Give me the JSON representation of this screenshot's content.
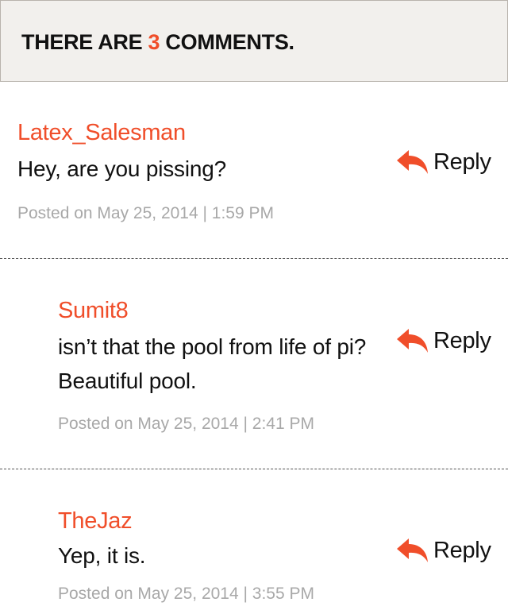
{
  "header": {
    "prefix": "There are ",
    "count": "3",
    "suffix": " comments."
  },
  "comments": [
    {
      "author": "Latex_Salesman",
      "text": "Hey, are you pissing?",
      "meta": "Posted on May 25, 2014 | 1:59 PM",
      "reply_label": "Reply"
    },
    {
      "author": "Sumit8",
      "text": "isn’t that the pool from life of pi? Beautiful pool.",
      "meta": "Posted on May 25, 2014 | 2:41 PM",
      "reply_label": "Reply"
    },
    {
      "author": "TheJaz",
      "text": "Yep, it is.",
      "meta": "Posted on May 25, 2014 | 3:55 PM",
      "reply_label": "Reply"
    }
  ],
  "colors": {
    "accent": "#f04e2a",
    "header_bg": "#f2f0ed",
    "meta_text": "#a8a8a8"
  },
  "icons": {
    "reply": "reply-arrow-icon"
  }
}
